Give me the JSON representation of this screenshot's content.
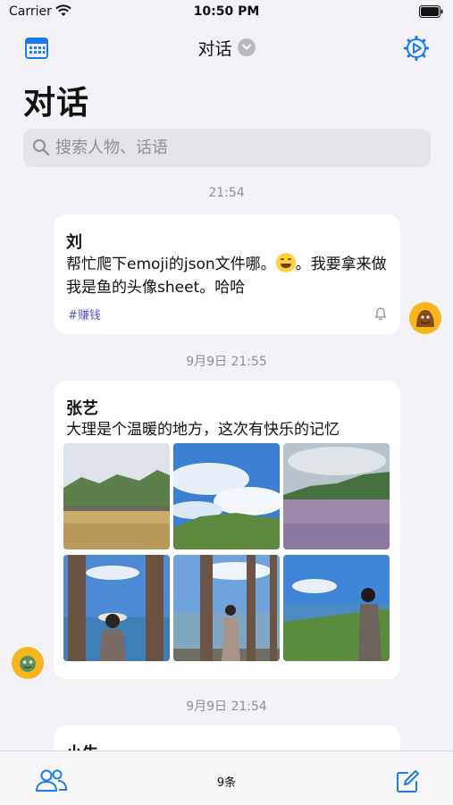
{
  "status_bar": {
    "carrier": "Carrier",
    "time": "10:50 PM"
  },
  "nav": {
    "title": "对话"
  },
  "page": {
    "large_title": "对话"
  },
  "search": {
    "placeholder": "搜索人物、话语",
    "value": ""
  },
  "accent_color": "#1a7cf5",
  "tag_color": "#5856d6",
  "feed": [
    {
      "timestamp": "21:54",
      "name": "刘",
      "text_before_emoji": "帮忙爬下emoji的json文件哪。",
      "emoji": "grinning-face",
      "text_after_emoji": "。我要拿来做我是鱼的头像sheet。哈哈",
      "tag": "#赚钱",
      "avatar_side": "right"
    },
    {
      "timestamp": "9月9日 21:55",
      "name": "张艺",
      "text": "大理是个温暖的地方，这次有快乐的记忆",
      "photos": [
        "wheat-field-landscape",
        "blue-sky-clouds-hill",
        "lavender-field-hills",
        "person-in-hat-by-lake",
        "person-between-trees-lake",
        "person-by-grassy-shore"
      ],
      "avatar_side": "left"
    },
    {
      "timestamp": "9月9日 21:54",
      "name": "小牛"
    }
  ],
  "tab_bar": {
    "count_label": "9条"
  }
}
